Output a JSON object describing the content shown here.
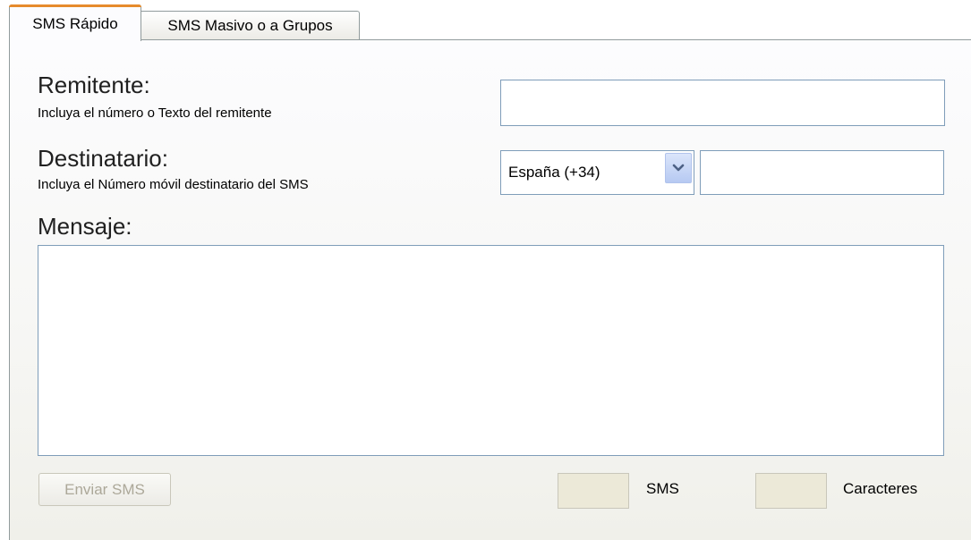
{
  "tabs": [
    {
      "label": "SMS Rápido",
      "active": true
    },
    {
      "label": "SMS Masivo o a Grupos",
      "active": false
    }
  ],
  "form": {
    "remitente": {
      "label": "Remitente:",
      "hint": "Incluya el número o Texto del remitente",
      "value": ""
    },
    "destinatario": {
      "label": "Destinatario:",
      "hint": "Incluya el Número móvil destinatario del SMS",
      "country_selected": "España  (+34)",
      "number_value": ""
    },
    "mensaje": {
      "label": "Mensaje:",
      "value": ""
    }
  },
  "footer": {
    "send_button": "Enviar SMS",
    "sms_count_label": "SMS",
    "sms_count_value": "",
    "char_count_label": "Caracteres",
    "char_count_value": ""
  },
  "icons": {
    "dropdown_arrow": "chevron-down-icon"
  },
  "colors": {
    "active_tab_accent": "#e68b2c",
    "input_border": "#7f9db9",
    "disabled_text": "#aca899",
    "counter_fill": "#ece9d8"
  }
}
